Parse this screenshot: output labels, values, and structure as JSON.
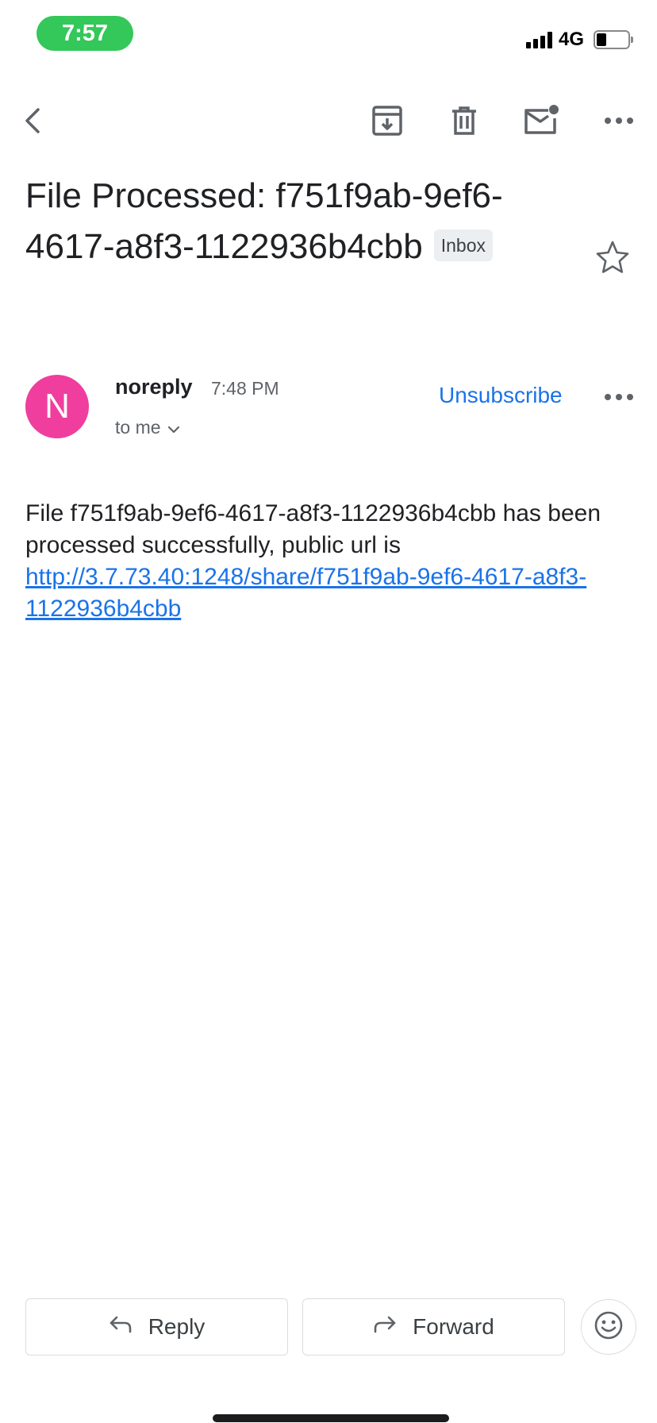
{
  "status_bar": {
    "time": "7:57",
    "network": "4G"
  },
  "toolbar": {
    "icons": [
      "back-icon",
      "archive-icon",
      "delete-icon",
      "mark-unread-icon",
      "more-icon"
    ]
  },
  "email": {
    "subject": "File Processed: f751f9ab-9ef6-4617-a8f3-1122936b4cbb",
    "label": "Inbox",
    "sender": {
      "initial": "N",
      "name": "noreply",
      "time": "7:48 PM",
      "recipient": "to me"
    },
    "unsubscribe_label": "Unsubscribe",
    "body": {
      "text": "File f751f9ab-9ef6-4617-a8f3-1122936b4cbb has been processed successfully, public url is ",
      "link": "http://3.7.73.40:1248/share/f751f9ab-9ef6-4617-a8f3-1122936b4cbb"
    }
  },
  "actions": {
    "reply_label": "Reply",
    "forward_label": "Forward"
  },
  "colors": {
    "accent": "#1a73e8",
    "avatar": "#ef3e9e",
    "time_pill": "#34c759"
  }
}
